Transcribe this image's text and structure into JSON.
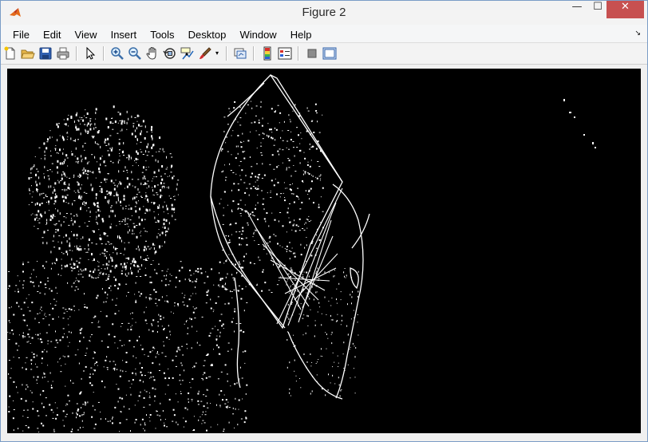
{
  "window": {
    "title": "Figure 2",
    "minimize_glyph": "—",
    "maximize_glyph": "☐",
    "close_glyph": "✕"
  },
  "menu": {
    "items": [
      "File",
      "Edit",
      "View",
      "Insert",
      "Tools",
      "Desktop",
      "Window",
      "Help"
    ],
    "dock_glyph": "↘"
  },
  "toolbar": {
    "icons": [
      "new-figure-icon",
      "open-file-icon",
      "save-figure-icon",
      "print-figure-icon",
      "edit-plot-icon",
      "zoom-in-icon",
      "zoom-out-icon",
      "pan-icon",
      "rotate-3d-icon",
      "data-cursor-icon",
      "brush-icon",
      "brush-dropdown-icon",
      "link-plot-icon",
      "insert-colorbar-icon",
      "insert-legend-icon",
      "hide-plot-tools-icon",
      "show-plot-tools-icon"
    ]
  },
  "figure": {
    "background": "#000000",
    "edge_color": "#ffffff"
  }
}
